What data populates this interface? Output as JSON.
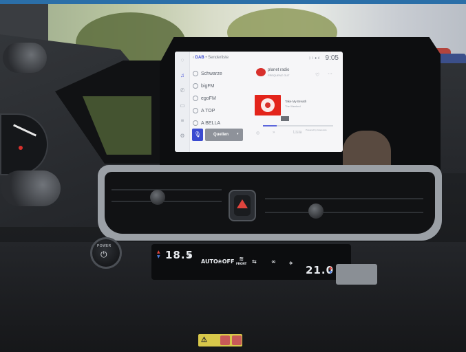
{
  "infotainment": {
    "breadcrumb": {
      "source": "DAB",
      "separator": "•",
      "view": "Senderliste"
    },
    "status_icons": [
      "bluetooth-icon",
      "wifi-icon",
      "battery-icon",
      "signal-icon"
    ],
    "clock": "9:05",
    "rail_icons": [
      "phone-icon",
      "music-icon",
      "call-icon",
      "car-icon",
      "list-icon",
      "settings-icon"
    ],
    "stations": [
      {
        "name": "Schwarze"
      },
      {
        "name": "bigFM"
      },
      {
        "name": "egoFM"
      },
      {
        "name": "A TOP"
      },
      {
        "name": "A BELLA"
      }
    ],
    "now_playing": {
      "station": "planet radio",
      "station_sub": "FREQUENZ GUT",
      "track": "Take My Breath",
      "artist": "The Weeknd",
      "progress": 0.2,
      "powered_by": "Powered by Gracenote"
    },
    "sources_button": "Quellen",
    "scan_label": "Liste",
    "colors": {
      "accent": "#3a4ad0",
      "album_art": "#e3241b",
      "station_logo": "#d8302c"
    }
  },
  "console": {
    "power_label": "POWER",
    "left_temp": "18.5",
    "right_temp": "21.0",
    "auto_label": "AUTO",
    "off_label": "OFF",
    "front_label": "FRONT"
  }
}
